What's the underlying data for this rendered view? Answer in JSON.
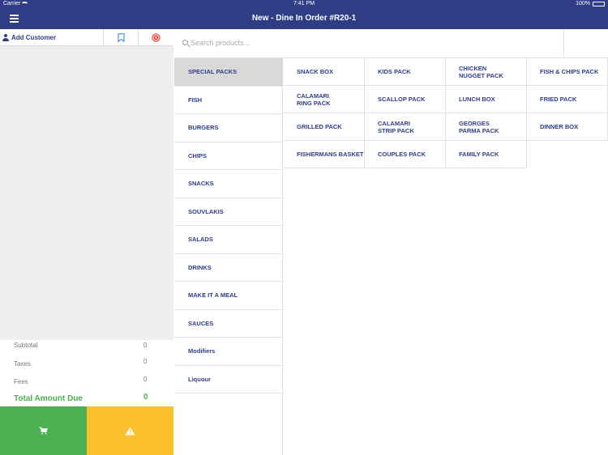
{
  "status_bar": {
    "carrier": "Carrier",
    "time": "7:41 PM",
    "battery": "100%"
  },
  "nav": {
    "title": "New - Dine In Order #R20-1",
    "menu_icon": "hamburger-menu-icon"
  },
  "order_toolbar": {
    "add_customer_label": "Add Customer",
    "bookmark_icon": "bookmark-icon",
    "clear_icon": "close-circle-icon",
    "clear_color": "#e53935"
  },
  "totals": {
    "subtotal_label": "Subtotal",
    "subtotal_value": "0",
    "taxes_label": "Taxes",
    "taxes_value": "0",
    "fees_label": "Fees",
    "fees_value": "0",
    "due_label": "Total Amount Due",
    "due_value": "0"
  },
  "actions": {
    "cart_icon": "cart-icon",
    "cart_color": "#4caf50",
    "warning_icon": "warning-icon",
    "warning_color": "#fbc02d"
  },
  "search": {
    "placeholder": "Search products..."
  },
  "categories": [
    "SPECIAL PACKS",
    "FISH",
    "BURGERS",
    "CHIPS",
    "SNACKS",
    "SOUVLAKIS",
    "SALADS",
    "DRINKS",
    "MAKE IT A MEAL",
    "SAUCES",
    "Modifiers",
    "Liquour"
  ],
  "selected_category": "SPECIAL PACKS",
  "products": [
    "SNACK BOX",
    "KIDS PACK",
    "CHICKEN\nNUGGET PACK",
    "FISH & CHIPS PACK",
    "CALAMARI\nRING PACK",
    "SCALLOP PACK",
    "LUNCH BOX",
    "FRIED PACK",
    "GRILLED PACK",
    "CALAMARI\nSTRIP PACK",
    "GEORGES\nPARMA PACK",
    "DINNER BOX",
    "FISHERMANS BASKET",
    "COUPLES PACK",
    "FAMILY PACK"
  ],
  "colors": {
    "brand": "#2f3d87",
    "accent_text": "#2f3d87",
    "selected_bg": "#d9d9d9"
  }
}
